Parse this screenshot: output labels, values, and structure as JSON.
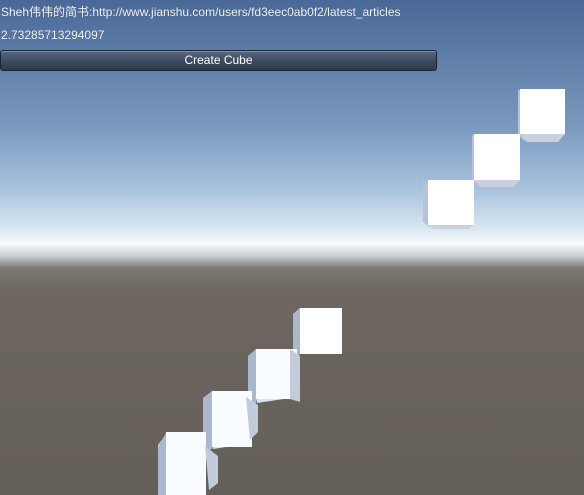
{
  "hud": {
    "url_text": "Sheh伟伟的简书:http://www.jianshu.com/users/fd3eec0ab0f2/latest_articles",
    "value_text": "2.73285713294097",
    "button_label": "Create Cube"
  },
  "colors": {
    "cube_face": "#ffffff",
    "cube_side": "#aebbd2",
    "cube_top": "#d9e0ec",
    "ground": "#665f5a",
    "sky": "#5c7aa6"
  },
  "cubes": {
    "upper_row_count": 3,
    "lower_row_count": 4
  }
}
